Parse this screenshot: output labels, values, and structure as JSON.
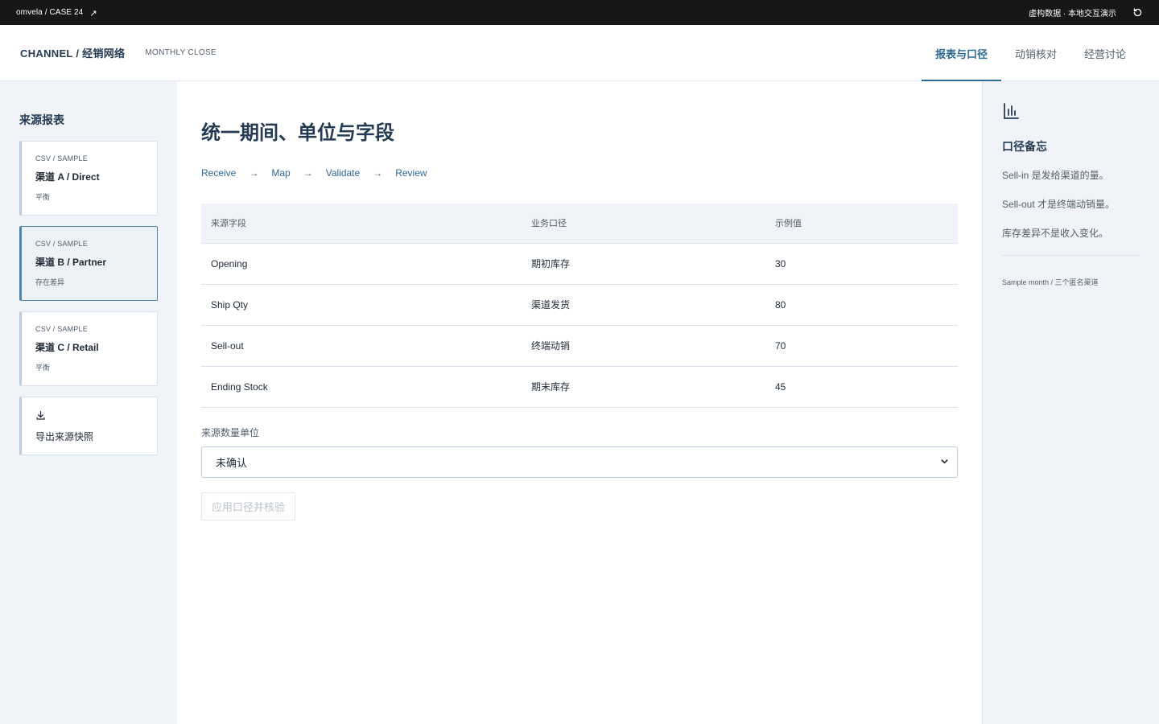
{
  "topbar": {
    "brand": "omvela / CASE 24",
    "brand_icon": "external-link-icon",
    "note": "虚构数据 · 本地交互演示",
    "refresh_icon": "refresh-icon"
  },
  "header": {
    "title": "CHANNEL / 经销网络",
    "subtitle": "MONTHLY CLOSE",
    "tabs": [
      {
        "label": "报表与口径",
        "active": true
      },
      {
        "label": "动销核对",
        "active": false
      },
      {
        "label": "经营讨论",
        "active": false
      }
    ]
  },
  "sidebar": {
    "title": "来源报表",
    "sources": [
      {
        "kind": "CSV / SAMPLE",
        "name": "渠道 A / Direct",
        "status": "平衡"
      },
      {
        "kind": "CSV / SAMPLE",
        "name": "渠道 B / Partner",
        "status": "存在差异"
      },
      {
        "kind": "CSV / SAMPLE",
        "name": "渠道 C / Retail",
        "status": "平衡"
      }
    ],
    "export_label": "导出来源快照",
    "export_icon": "download-icon"
  },
  "main": {
    "title": "统一期间、单位与字段",
    "steps": [
      "Receive",
      "Map",
      "Validate",
      "Review"
    ],
    "table": {
      "headers": [
        "来源字段",
        "业务口径",
        "示例值"
      ],
      "rows": [
        [
          "Opening",
          "期初库存",
          "30"
        ],
        [
          "Ship Qty",
          "渠道发货",
          "80"
        ],
        [
          "Sell-out",
          "终端动销",
          "70"
        ],
        [
          "Ending Stock",
          "期末库存",
          "45"
        ]
      ]
    },
    "unit_label": "来源数量单位",
    "unit_value": "未确认",
    "apply_label": "应用口径并核验"
  },
  "aside": {
    "icon": "bar-chart-icon",
    "title": "口径备忘",
    "notes": [
      "Sell-in 是发给渠道的量。",
      "Sell-out 才是终端动销量。",
      "库存差异不是收入变化。"
    ],
    "footer": "Sample month / 三个匿名渠道"
  },
  "colors": {
    "accent": "#2c6a95",
    "topbar_bg": "#151719",
    "panel_bg": "#f0f4f8"
  }
}
